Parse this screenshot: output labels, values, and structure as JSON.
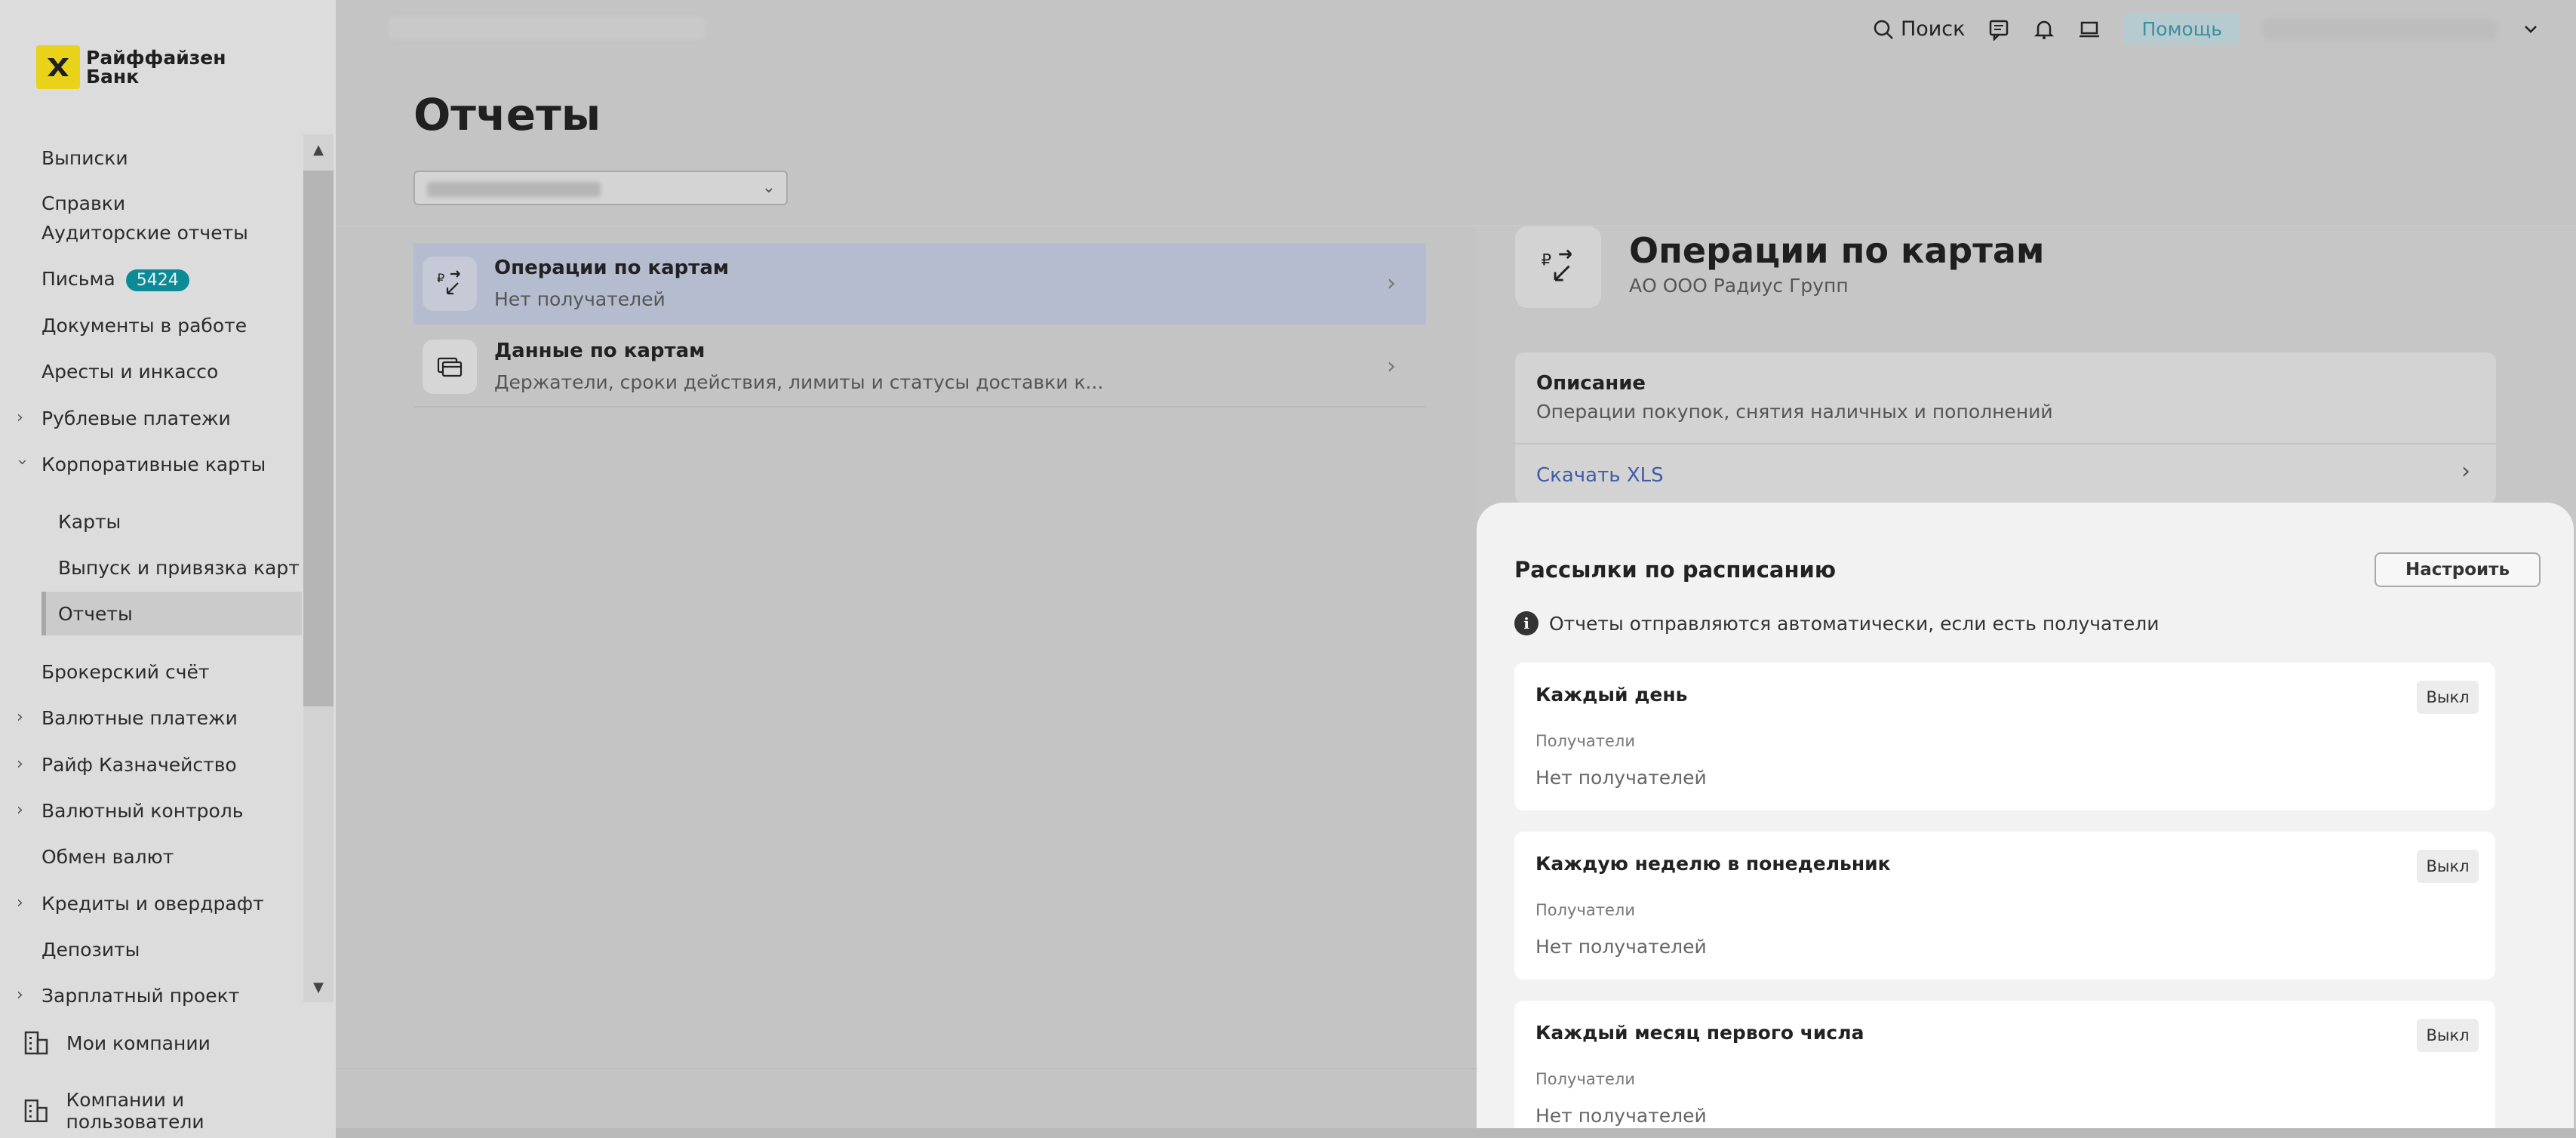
{
  "brand": {
    "name": "Райффайзен Банк",
    "line1": "Райффайзен",
    "line2": "Банк"
  },
  "header": {
    "search_label": "Поиск",
    "help_label": "Помощь"
  },
  "sidebar": {
    "items": [
      {
        "label": "Выписки"
      },
      {
        "label": "Справки"
      },
      {
        "label": "Аудиторские отчеты"
      },
      {
        "label": "Письма",
        "badge": "5424"
      },
      {
        "label": "Документы в работе"
      },
      {
        "label": "Аресты и инкассо"
      },
      {
        "label": "Рублевые платежи"
      },
      {
        "label": "Корпоративные карты"
      },
      {
        "label": "Карты"
      },
      {
        "label": "Выпуск и привязка карт"
      },
      {
        "label": "Отчеты"
      },
      {
        "label": "Брокерский счёт"
      },
      {
        "label": "Валютные платежи"
      },
      {
        "label": "Райф Казначейство"
      },
      {
        "label": "Валютный контроль"
      },
      {
        "label": "Обмен валют"
      },
      {
        "label": "Кредиты и овердрафт"
      },
      {
        "label": "Депозиты"
      },
      {
        "label": "Зарплатный проект"
      }
    ],
    "bottom": [
      {
        "label": "Мои компании"
      },
      {
        "label": "Компании и пользователи"
      }
    ]
  },
  "page": {
    "title": "Отчеты"
  },
  "reports": [
    {
      "title": "Операции по картам",
      "subtitle": "Нет получателей"
    },
    {
      "title": "Данные по картам",
      "subtitle": "Держатели, сроки действия, лимиты и статусы доставки к..."
    }
  ],
  "detail": {
    "title": "Операции по картам",
    "company": "АО ООО Радиус Групп",
    "description_label": "Описание",
    "description_text": "Операции покупок, снятия наличных и пополнений",
    "download_label": "Скачать XLS"
  },
  "schedule": {
    "title": "Рассылки по расписанию",
    "configure_label": "Настроить",
    "info_text": "Отчеты отправляются автоматически, если есть получатели",
    "cards": [
      {
        "title": "Каждый день",
        "toggle": "Выкл",
        "recipients_label": "Получатели",
        "recipients_value": "Нет получателей"
      },
      {
        "title": "Каждую неделю в понедельник",
        "toggle": "Выкл",
        "recipients_label": "Получатели",
        "recipients_value": "Нет получателей"
      },
      {
        "title": "Каждый месяц первого числа",
        "toggle": "Выкл",
        "recipients_label": "Получатели",
        "recipients_value": "Нет получателей"
      }
    ]
  },
  "colors": {
    "accent": "#0c8b96",
    "brand_yellow": "#e9d21a",
    "link": "#3f5da8",
    "selected_row": "#b5bcd0"
  },
  "icons": {
    "logo": "raiffeisen-logo-icon",
    "search": "search-icon",
    "chat": "chat-icon",
    "bell": "bell-icon",
    "laptop": "laptop-icon",
    "card_operations": "card-exchange-icon",
    "card_data": "cards-stack-icon",
    "buildings": "building-icon",
    "info": "info-icon"
  }
}
